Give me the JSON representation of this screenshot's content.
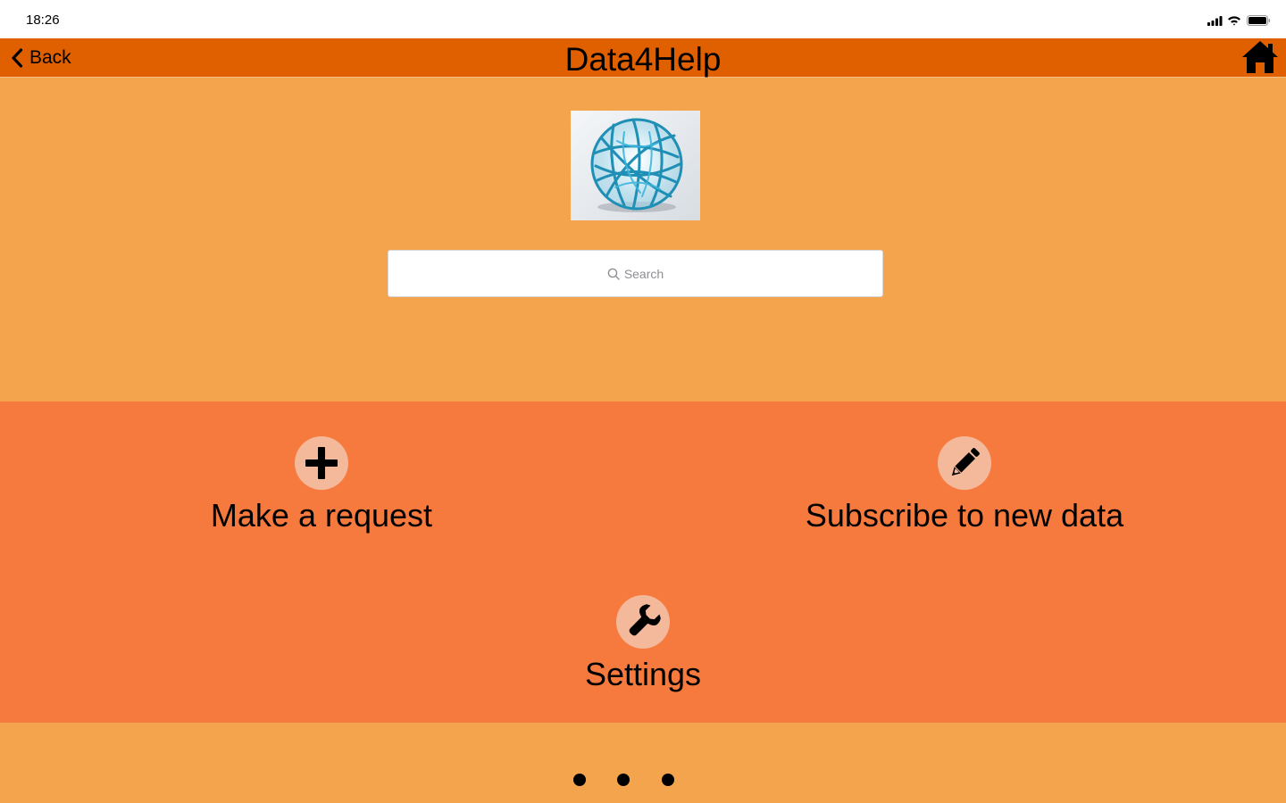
{
  "status_bar": {
    "time": "18:26"
  },
  "nav": {
    "back_label": "Back",
    "title": "Data4Help"
  },
  "search": {
    "placeholder": "Search"
  },
  "menu": {
    "items": [
      {
        "label": "Make a request",
        "icon": "plus-icon"
      },
      {
        "label": "Subscribe to new data",
        "icon": "pencil-icon"
      },
      {
        "label": "Settings",
        "icon": "wrench-icon"
      }
    ]
  },
  "pager": {
    "pages": 3
  },
  "colors": {
    "nav_bar": "#e06000",
    "background": "#f4a44c",
    "menu_panel": "#f67a3e",
    "icon_circle": "#f4b89a"
  }
}
